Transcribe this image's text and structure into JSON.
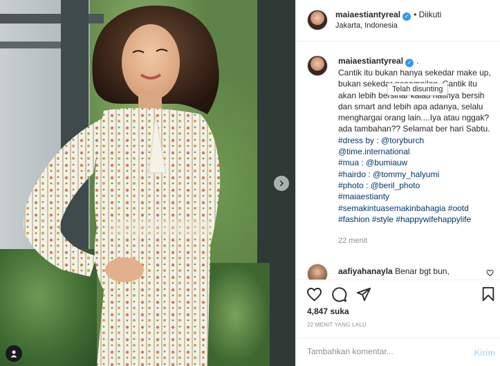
{
  "post": {
    "username": "maiaestiantyreal",
    "follow_status": "• Diikuti",
    "location": "Jakarta, Indonesia",
    "caption_username": "maiaestiantyreal",
    "caption_after_badge": ".",
    "caption_text": "Cantik itu bukan hanya sekedar make up, bukan sekedar penampilan. Cantik itu akan lebih bersinar kalau hatinya bersih dan smart and lebih apa adanya, selalu menghargai orang lain....Iya atau nggak? ada tambahan?? Selamat ber hari Sabtu.",
    "tags": [
      "#dress by : @toryburch",
      "@time.international",
      "#mua : @bumiauw",
      "#hairdo : @tommy_halyumi",
      "#photo : @beril_photo",
      "#maiaestianty",
      "#semakintuasemakinbahagia #ootd",
      "#fashion #style #happywifehappylife"
    ],
    "caption_time": "22 menit",
    "tooltip": "Telah disunting",
    "comment": {
      "username": "aafiyahanayla",
      "text": "Benar bgt bun,"
    },
    "likes": "4,847 suka",
    "posted_time": "22 MENIT YANG LALU"
  },
  "add_comment": {
    "placeholder": "Tambahkan komentar...",
    "post_label": "Kirim"
  },
  "colors": {
    "verified": "#3897f0",
    "link": "#003569",
    "muted": "#8e8e8e",
    "post_disabled": "#b2dffc"
  },
  "icons": [
    "heart-icon",
    "comment-icon",
    "share-icon",
    "bookmark-icon",
    "verified-icon",
    "chevron-right-icon",
    "user-icon"
  ]
}
